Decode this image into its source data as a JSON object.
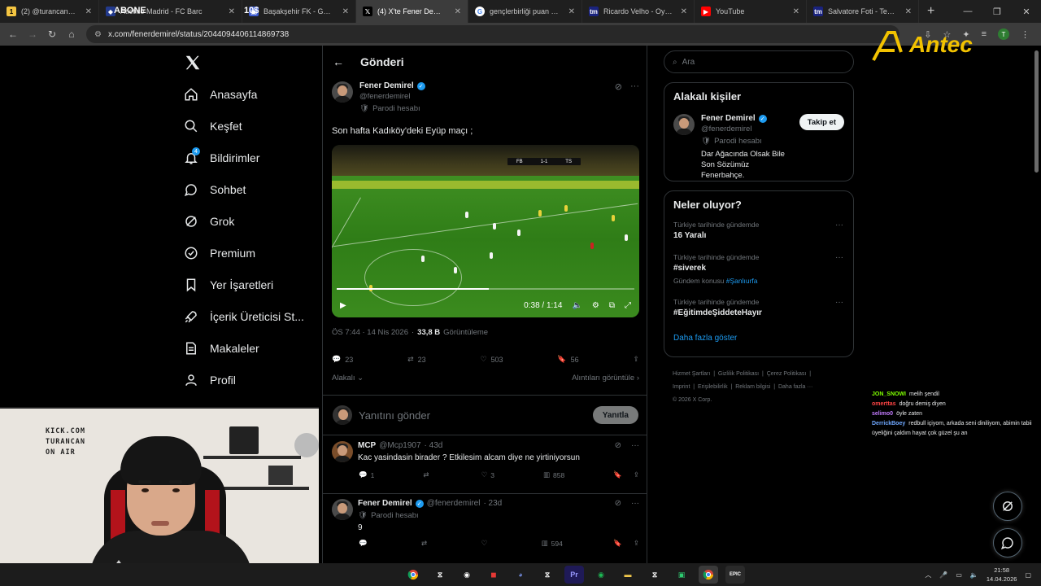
{
  "browser": {
    "tabs": [
      {
        "label": "(2) @turancan0/. / X",
        "active": false
      },
      {
        "label": "Atlético Madrid - FC Barc",
        "active": false
      },
      {
        "label": "Başakşehir FK - Gençlerbi",
        "active": false
      },
      {
        "label": "(4) X'te Fener Demirel: \"S",
        "active": true
      },
      {
        "label": "gençlerbirliği puan durum",
        "active": false
      },
      {
        "label": "Ricardo Velho - Oyuncu p",
        "active": false
      },
      {
        "label": "YouTube",
        "active": false
      },
      {
        "label": "Salvatore Foti - Teknik Di",
        "active": false
      }
    ],
    "overlay_texts": [
      "ABONE",
      "10$"
    ],
    "url": "x.com/fenerdemirel/status/2044094406114869738",
    "new_tab": "+",
    "profile_initial": "T"
  },
  "brand_overlay": "Antec",
  "nav": {
    "items": [
      {
        "label": "Anasayfa",
        "icon": "home-icon"
      },
      {
        "label": "Keşfet",
        "icon": "search-icon"
      },
      {
        "label": "Bildirimler",
        "icon": "bell-icon",
        "badge": "4"
      },
      {
        "label": "Sohbet",
        "icon": "chat-icon"
      },
      {
        "label": "Grok",
        "icon": "grok-icon"
      },
      {
        "label": "Premium",
        "icon": "premium-icon"
      },
      {
        "label": "Yer İşaretleri",
        "icon": "bookmark-icon"
      },
      {
        "label": "İçerik Üreticisi St...",
        "icon": "rocket-icon"
      },
      {
        "label": "Makaleler",
        "icon": "article-icon"
      },
      {
        "label": "Profil",
        "icon": "profile-icon"
      }
    ]
  },
  "post": {
    "header": "Gönderi",
    "author_name": "Fener Demirel",
    "author_handle": "@fenerdemirel",
    "parody_label": "Parodi hesabı",
    "text": "Son hafta Kadıköy'deki Eyüp maçı ;",
    "video": {
      "time": "0:38 / 1:14",
      "progress": 0.51,
      "score_home": "FB",
      "score": "1-1",
      "score_away": "TS"
    },
    "time": "ÖS 7:44 · 14 Nis 2026",
    "views_num": "33,8 B",
    "views_label": "Görüntüleme",
    "stats": {
      "replies": "23",
      "reposts": "23",
      "likes": "503",
      "bookmarks": "56"
    },
    "sort_label": "Alakalı",
    "quotes_label": "Alıntıları görüntüle"
  },
  "reply_box": {
    "placeholder": "Yanıtını gönder",
    "button": "Yanıtla"
  },
  "replies": [
    {
      "name": "MCP",
      "handle": "@Mcp1907",
      "age": "· 43d",
      "text": "Kac yasindasin birader ? Etkilesim alcam diye ne yirtiniyorsun",
      "replies": "1",
      "reposts": "",
      "likes": "3",
      "views": "858"
    },
    {
      "name": "Fener Demirel",
      "handle": "@fenerdemirel",
      "age": "· 23d",
      "parody": "Parodi hesabı",
      "text": "9",
      "replies": "",
      "reposts": "",
      "likes": "",
      "views": "594"
    }
  ],
  "right": {
    "search_placeholder": "Ara",
    "related": {
      "title": "Alakalı kişiler",
      "name": "Fener Demirel",
      "handle": "@fenerdemirel",
      "parody": "Parodi hesabı",
      "bio": "Dar Ağacında Olsak Bile Son Sözümüz Fenerbahçe.",
      "follow": "Takip et"
    },
    "trends": {
      "title": "Neler oluyor?",
      "items": [
        {
          "category": "Türkiye tarihinde gündemde",
          "title": "16 Yaralı",
          "sub": "",
          "link": ""
        },
        {
          "category": "Türkiye tarihinde gündemde",
          "title": "#siverek",
          "sub": "Gündem konusu",
          "link": "#Şanlıurfa"
        },
        {
          "category": "Türkiye tarihinde gündemde",
          "title": "#EğitimdeŞiddeteHayır",
          "sub": "",
          "link": ""
        }
      ],
      "show_more": "Daha fazla göster"
    },
    "footer": [
      "Hizmet Şartları",
      "|",
      "Gizlilik Politikası",
      "|",
      "Çerez Politikası",
      "|",
      "Imprint",
      "|",
      "Erişilebilirlik",
      "|",
      "Reklam bilgisi",
      "|",
      "Daha fazla ···",
      "© 2026 X Corp."
    ]
  },
  "chat": [
    {
      "user": "JON_SNOWI",
      "color": "#7fff00",
      "msg": "melih şendil"
    },
    {
      "user": "omerttas",
      "color": "#ff4545",
      "msg": "doğru demiş diyen"
    },
    {
      "user": "selimo0",
      "color": "#c47cff",
      "msg": "öyle zaten"
    },
    {
      "user": "DerrickBoey",
      "color": "#6fa8ff",
      "msg": "redbull içiyom, arkada seni diniliyom, abimin tabii üyeliğini çaldım hayat çok güzel şu an"
    }
  ],
  "webcam_sign": [
    "KICK.COM",
    "TURANCAN",
    "ON AIR"
  ],
  "taskbar": {
    "time": "21:58",
    "date": "14.04.2026",
    "apps": [
      "chrome-icon",
      "capcut-icon",
      "obs-icon",
      "app-red-icon",
      "discord-icon",
      "capcut2-icon",
      "premiere-icon",
      "spotify-icon",
      "folder-icon",
      "capcut3-icon",
      "app-green-icon",
      "chrome2-icon",
      "epic-icon"
    ],
    "app_labels": {
      "premiere": "Pr",
      "epic": "EPIC"
    }
  },
  "colors": {
    "accent": "#1d9bf0",
    "bg": "#000000",
    "muted": "#71767b",
    "text": "#e7e9ea"
  }
}
